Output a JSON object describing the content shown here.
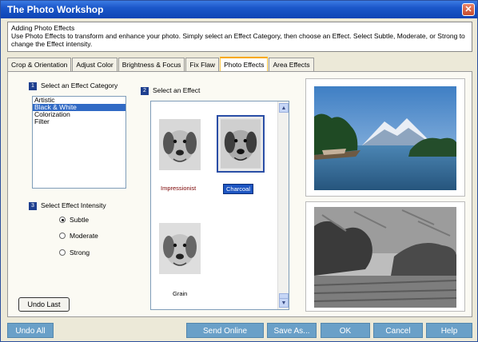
{
  "window": {
    "title": "The Photo Workshop"
  },
  "info": {
    "heading": "Adding Photo Effects",
    "text": "Use Photo Effects to transform and enhance your photo.  Simply select an Effect Category, then choose an Effect.  Select Subtle, Moderate, or Strong to change the Effect intensity."
  },
  "tabs": [
    {
      "label": "Crop & Orientation",
      "active": false
    },
    {
      "label": "Adjust Color",
      "active": false
    },
    {
      "label": "Brightness & Focus",
      "active": false
    },
    {
      "label": "Fix Flaw",
      "active": false
    },
    {
      "label": "Photo Effects",
      "active": true
    },
    {
      "label": "Area Effects",
      "active": false
    }
  ],
  "category": {
    "step": "1",
    "label": "Select an Effect Category",
    "items": [
      "Artistic",
      "Black & White",
      "Colorization",
      "Filter"
    ],
    "selected": "Black & White"
  },
  "intensity": {
    "step": "3",
    "label": "Select Effect Intensity",
    "options": [
      "Subtle",
      "Moderate",
      "Strong"
    ],
    "selected": "Subtle"
  },
  "effect": {
    "step": "2",
    "label": "Select an Effect",
    "items": [
      "Impressionist",
      "Charcoal",
      "Grain"
    ],
    "selected": "Charcoal"
  },
  "buttons": {
    "undo_last": "Undo Last",
    "undo_all": "Undo All",
    "send_online": "Send Online",
    "save_as": "Save As...",
    "ok": "OK",
    "cancel": "Cancel",
    "help": "Help"
  },
  "icons": {
    "close": "close-icon",
    "scroll_up": "chevron-up-icon",
    "scroll_down": "chevron-down-icon"
  },
  "colors": {
    "titlebar": "#1b57c9",
    "selection": "#316ac5",
    "bottom_button": "#6aa0c8",
    "active_tab": "#f8a800"
  }
}
